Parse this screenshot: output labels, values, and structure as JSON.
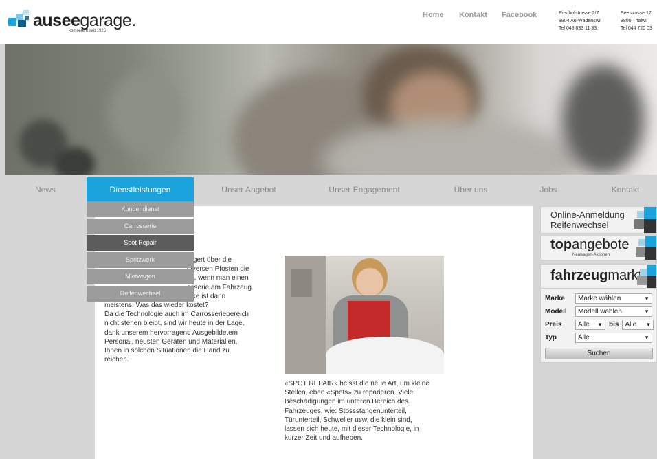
{
  "brand": {
    "name_bold": "ausee",
    "name_light": "garage.",
    "tagline": "kompetent seit 1926"
  },
  "topnav": {
    "home": "Home",
    "kontakt": "Kontakt",
    "facebook": "Facebook"
  },
  "addresses": [
    {
      "street": "Riedhofstrasse 2/7",
      "city": "8804 Au-Wädenswil",
      "phone": "Tel 043 833 11 33"
    },
    {
      "street": "Seestrasse 17",
      "city": "8800 Thalwil",
      "phone": "Tel 044 720 03"
    }
  ],
  "mainnav": [
    "News",
    "Dienstleistungen",
    "Unser Angebot",
    "Unser Engagement",
    "Über uns",
    "Jobs",
    "Kontakt"
  ],
  "dropdown": [
    "Kundendienst",
    "Carrosserie",
    "Spot Repair",
    "Spritzwerk",
    "Mietwagen",
    "Reifenwechsel"
  ],
  "content": {
    "left_lines": [
      "ärgert über die",
      "diversen Pfosten die",
      "es, wenn man einen",
      "osserie am Fahrzeug",
      "beschädigt. Der erste Gedanke ist dann",
      "meistens: Was das wieder kostet?",
      "Da die Technologie auch im Carrosseriebereich",
      "nicht stehen bleibt, sind wir heute in der Lage,",
      "dank unserem hervorragend Ausgebildetem",
      "Personal, neusten Geräten und Materialien,",
      "Ihnen in solchen Situationen die Hand zu",
      "reichen."
    ],
    "caption_lines": [
      "«SPOT REPAIR» heisst die neue Art, um kleine",
      "Stellen, eben «Spots» zu reparieren. Viele",
      "Beschädigungen im unteren Bereich des",
      "Fahrzeuges, wie: Stossstangenunterteil,",
      "Türunterteil, Schweller usw. die klein sind,",
      "lassen sich heute, mit dieser Technologie, in",
      "kurzer Zeit und aufheben."
    ]
  },
  "sidebar": {
    "online_line1": "Online-Anmeldung",
    "online_line2": "Reifenwechsel",
    "top_bold": "top",
    "top_light": "angebote",
    "top_sub": "Neuwagen-Aktionen",
    "fm_bold": "fahrzeug",
    "fm_light": "markt"
  },
  "search": {
    "marke_label": "Marke",
    "marke_value": "Marke wählen",
    "modell_label": "Modell",
    "modell_value": "Modell wählen",
    "preis_label": "Preis",
    "preis_from": "Alle",
    "bis_label": "bis",
    "preis_to": "Alle",
    "typ_label": "Typ",
    "typ_value": "Alle",
    "button": "Suchen"
  },
  "colors": {
    "accent": "#1aa3dc",
    "dropdown_bg": "#9b9b9b",
    "dropdown_selected": "#5c5c5c"
  }
}
